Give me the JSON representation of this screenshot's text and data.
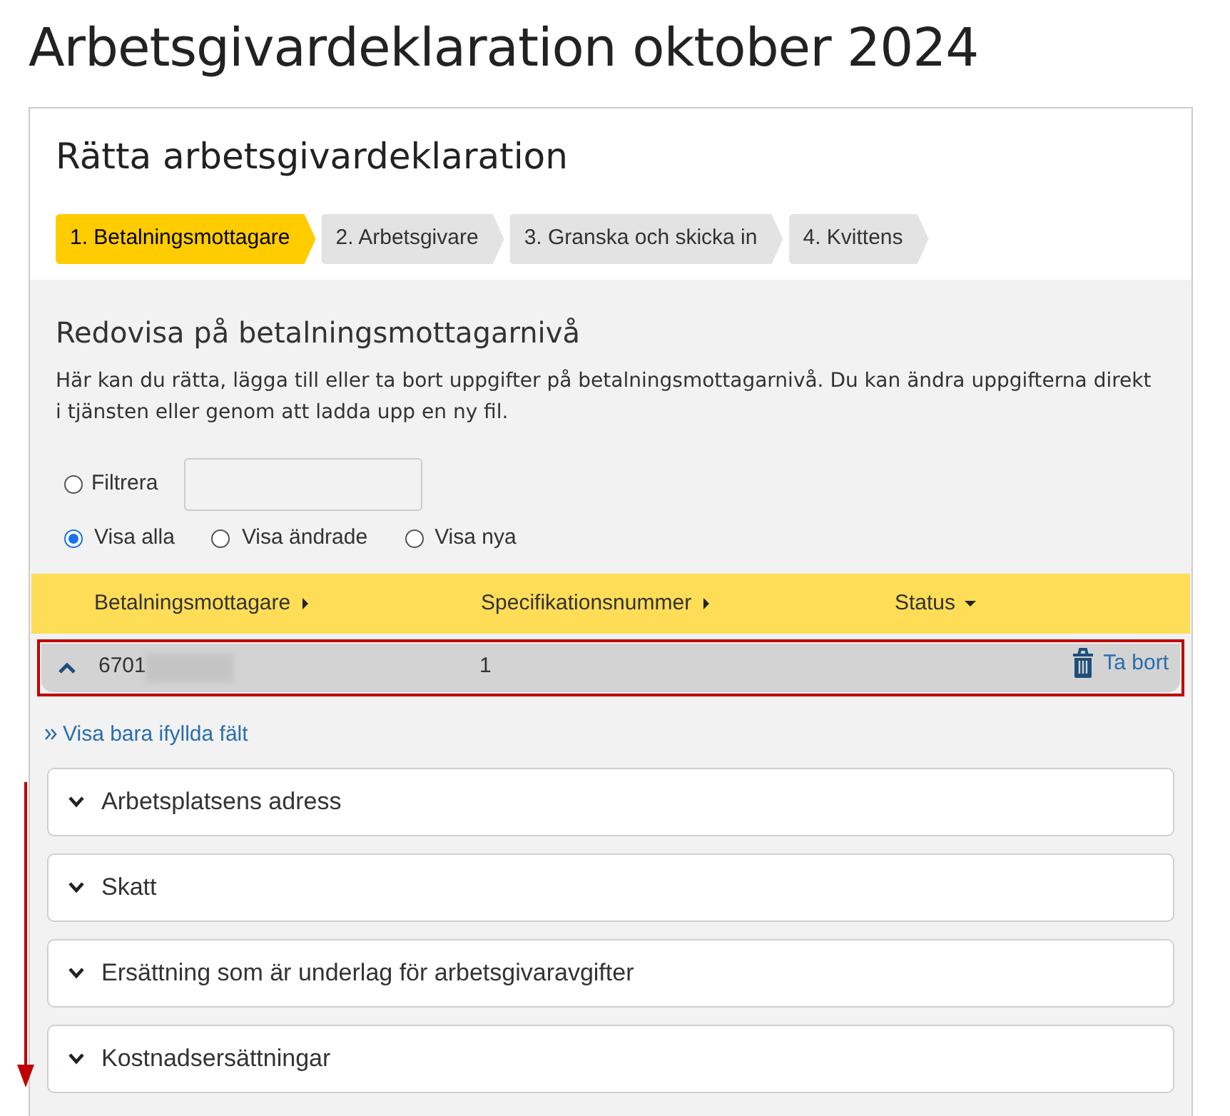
{
  "page_title": "Arbetsgivardeklaration oktober 2024",
  "card_title": "Rätta arbetsgivardeklaration",
  "steps": [
    {
      "label": "1. Betalningsmottagare",
      "selected": true
    },
    {
      "label": "2. Arbetsgivare",
      "selected": false
    },
    {
      "label": "3. Granska och skicka in",
      "selected": false
    },
    {
      "label": "4. Kvittens",
      "selected": false
    }
  ],
  "section_title": "Redovisa på betalningsmottagarnivå",
  "description": "Här kan du rätta, lägga till eller ta bort uppgifter på betalningsmottagarnivå. Du kan ändra uppgifterna direkt i tjänsten eller genom att ladda upp en ny fil.",
  "filter": {
    "label": "Filtrera",
    "selected": false
  },
  "view_options": [
    {
      "label": "Visa alla",
      "selected": true
    },
    {
      "label": "Visa ändrade",
      "selected": false
    },
    {
      "label": "Visa nya",
      "selected": false
    }
  ],
  "table": {
    "columns": [
      {
        "label": "Betalningsmottagare",
        "kind": "sortable"
      },
      {
        "label": "Specifikationsnummer",
        "kind": "sortable"
      },
      {
        "label": "Status",
        "kind": "menu"
      }
    ],
    "rows": [
      {
        "payee": "6701",
        "payee_blurred": true,
        "spec": "1",
        "expanded": true,
        "delete": "Ta bort",
        "highlighted": true
      }
    ]
  },
  "show_filled_link": "Visa bara ifyllda fält",
  "sections": [
    {
      "label": "Arbetsplatsens adress",
      "expanded": false
    },
    {
      "label": "Skatt",
      "expanded": false
    },
    {
      "label": "Ersättning som är underlag för arbetsgivaravgifter",
      "expanded": false
    },
    {
      "label": "Kostnadsersättningar",
      "expanded": false
    }
  ]
}
